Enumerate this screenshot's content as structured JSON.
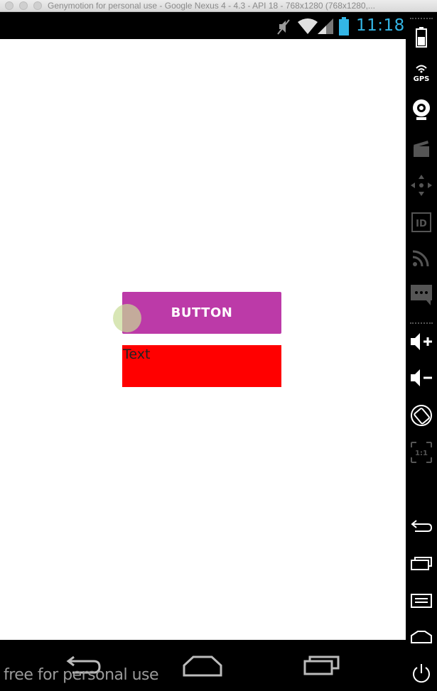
{
  "window": {
    "title": "Genymotion for personal use - Google Nexus 4 - 4.3 - API 18 - 768x1280 (768x1280,..."
  },
  "statusbar": {
    "time": "11:18",
    "icons": [
      "mute-icon",
      "wifi-icon",
      "signal-icon",
      "battery-icon"
    ],
    "clock_color": "#33b5e5"
  },
  "app": {
    "button_label": "BUTTON",
    "button_color": "#bc3aa8",
    "text_label": "Text",
    "text_bg_color": "#ff0000"
  },
  "toolbar": {
    "items": [
      {
        "name": "battery-tool-icon"
      },
      {
        "name": "gps-tool-icon",
        "label": "GPS"
      },
      {
        "name": "webcam-tool-icon"
      },
      {
        "name": "screencast-tool-icon"
      },
      {
        "name": "dpad-tool-icon"
      },
      {
        "name": "device-id-tool-icon",
        "label": "ID"
      },
      {
        "name": "network-tool-icon"
      },
      {
        "name": "sms-tool-icon"
      },
      {
        "name": "volume-up-icon"
      },
      {
        "name": "volume-down-icon"
      },
      {
        "name": "rotate-icon"
      },
      {
        "name": "pixel-perfect-icon",
        "label": "1:1"
      },
      {
        "name": "back-icon"
      },
      {
        "name": "recent-apps-icon"
      },
      {
        "name": "menu-icon"
      },
      {
        "name": "home-icon"
      },
      {
        "name": "power-icon"
      }
    ]
  },
  "navbar": {
    "buttons": [
      "back",
      "home",
      "recent-apps"
    ]
  },
  "watermark": "free for personal use"
}
